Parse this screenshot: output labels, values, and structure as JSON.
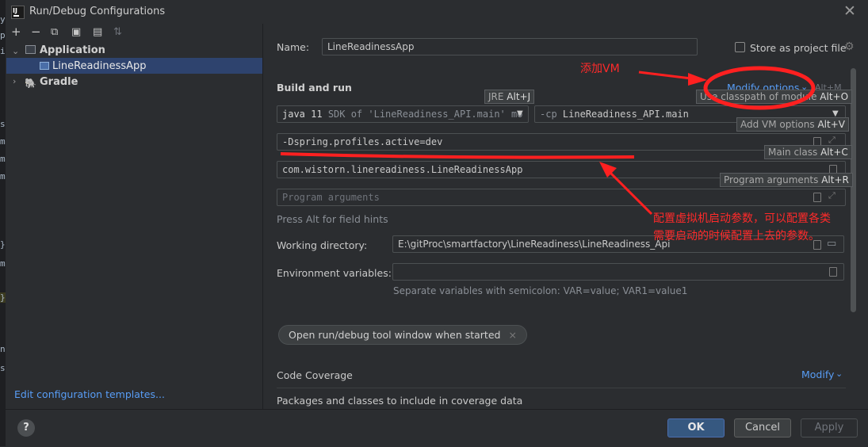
{
  "window": {
    "title": "Run/Debug Configurations",
    "app_icon_letter": "IJ"
  },
  "editor_edge_chars": [
    "y",
    "p",
    "i",
    "",
    "s",
    "m",
    "m",
    "m",
    "",
    "",
    "}",
    "m",
    "",
    "}",
    "",
    "n",
    "si"
  ],
  "toolbar": {
    "add": "+",
    "remove": "−",
    "copy": "⧉",
    "save": "▣",
    "folder": "▤",
    "sort": "⇅"
  },
  "tree": {
    "items": [
      {
        "label": "Application",
        "expanded": true
      },
      {
        "label": "LineReadinessApp",
        "selected": true
      },
      {
        "label": "Gradle",
        "expanded": false
      }
    ]
  },
  "left_footer": {
    "link": "Edit configuration templates..."
  },
  "form": {
    "name_label": "Name:",
    "name_value": "LineReadinessApp",
    "store_label": "Store as project file",
    "section_title": "Build and run",
    "modify_options": "Modify options",
    "modify_shortcut": "Alt+M",
    "jre_value": "java 11",
    "jre_detail": "SDK of 'LineReadiness_API.main' mo",
    "cp_prefix": "-cp",
    "cp_value": "LineReadiness_API.main",
    "vm_options": "-Dspring.profiles.active=dev",
    "main_class": "com.wistorn.linereadiness.LineReadinessApp",
    "program_args_placeholder": "Program arguments",
    "hint": "Press Alt for field hints",
    "workdir_label": "Working directory:",
    "workdir_value": "E:\\gitProc\\smartfactory\\LineReadiness\\LineReadiness_Api",
    "env_label": "Environment variables:",
    "env_help": "Separate variables with semicolon: VAR=value; VAR1=value1",
    "chip_label": "Open run/debug tool window when started",
    "chip_close": "×",
    "coverage_label": "Code Coverage",
    "coverage_modify": "Modify",
    "coverage_sub": "Packages and classes to include in coverage data"
  },
  "tooltips": {
    "jre": {
      "text": "JRE",
      "key": "Alt+J"
    },
    "classpath": {
      "text": "Use classpath of module",
      "key": "Alt+O"
    },
    "vm": {
      "text": "Add VM options",
      "key": "Alt+V"
    },
    "main": {
      "text": "Main class",
      "key": "Alt+C"
    },
    "program": {
      "text": "Program arguments",
      "key": "Alt+R"
    }
  },
  "annotations": {
    "add_vm": "添加VM",
    "note_line1": "配置虚拟机启动参数，可以配置各类",
    "note_line2": "需要启动的时候配置上去的参数。",
    "color": "#ff2a2a"
  },
  "buttons": {
    "help": "?",
    "ok": "OK",
    "cancel": "Cancel",
    "apply": "Apply"
  },
  "colors": {
    "background": "#2b2d30",
    "selection": "#2e436e",
    "link": "#589df6",
    "primary_button": "#365880"
  }
}
